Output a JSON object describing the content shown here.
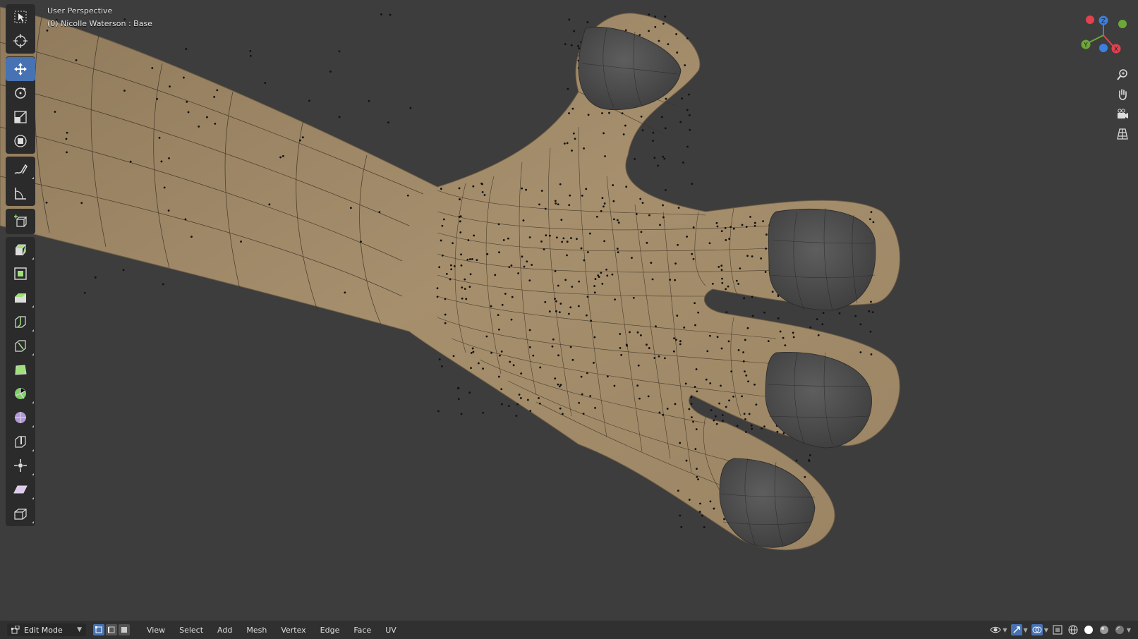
{
  "viewport": {
    "view_name": "User Perspective",
    "object_label": "(0) Nicolle Waterson : Base"
  },
  "colors": {
    "background": "#3d3d3d",
    "skin": "#a48d6c",
    "nails": "#505050",
    "active_tool": "#4772b3",
    "gizmo_x": "#e2414f",
    "gizmo_y": "#6ca836",
    "gizmo_z": "#3b7fe0"
  },
  "toolbar": {
    "tools": [
      {
        "name": "select-box-tool",
        "icon": "select-box-icon"
      },
      {
        "name": "cursor-tool",
        "icon": "cursor-icon"
      },
      {
        "name": "move-tool",
        "icon": "move-icon",
        "active": true
      },
      {
        "name": "rotate-tool",
        "icon": "rotate-icon"
      },
      {
        "name": "scale-tool",
        "icon": "scale-icon"
      },
      {
        "name": "transform-tool",
        "icon": "transform-icon"
      },
      {
        "name": "annotate-tool",
        "icon": "annotate-icon"
      },
      {
        "name": "measure-tool",
        "icon": "measure-icon"
      },
      {
        "name": "add-cube-tool",
        "icon": "add-cube-icon"
      },
      {
        "name": "extrude-tool",
        "icon": "extrude-icon"
      },
      {
        "name": "inset-tool",
        "icon": "inset-icon"
      },
      {
        "name": "bevel-tool",
        "icon": "bevel-icon"
      },
      {
        "name": "loop-cut-tool",
        "icon": "loop-cut-icon"
      },
      {
        "name": "knife-tool",
        "icon": "knife-icon"
      },
      {
        "name": "poly-build-tool",
        "icon": "poly-build-icon"
      },
      {
        "name": "spin-tool",
        "icon": "spin-icon"
      },
      {
        "name": "smooth-tool",
        "icon": "smooth-icon"
      },
      {
        "name": "edge-slide-tool",
        "icon": "edge-slide-icon"
      },
      {
        "name": "shrink-fatten-tool",
        "icon": "shrink-fatten-icon"
      },
      {
        "name": "shear-tool",
        "icon": "shear-icon"
      },
      {
        "name": "rip-tool",
        "icon": "rip-icon"
      }
    ]
  },
  "gizmo": {
    "x_label": "X",
    "y_label": "Y",
    "z_label": "Z"
  },
  "nav": [
    "zoom-icon",
    "pan-hand-icon",
    "camera-icon",
    "ortho-grid-icon"
  ],
  "header": {
    "mode": "Edit Mode",
    "menus": [
      "View",
      "Select",
      "Add",
      "Mesh",
      "Vertex",
      "Edge",
      "Face",
      "UV"
    ]
  }
}
